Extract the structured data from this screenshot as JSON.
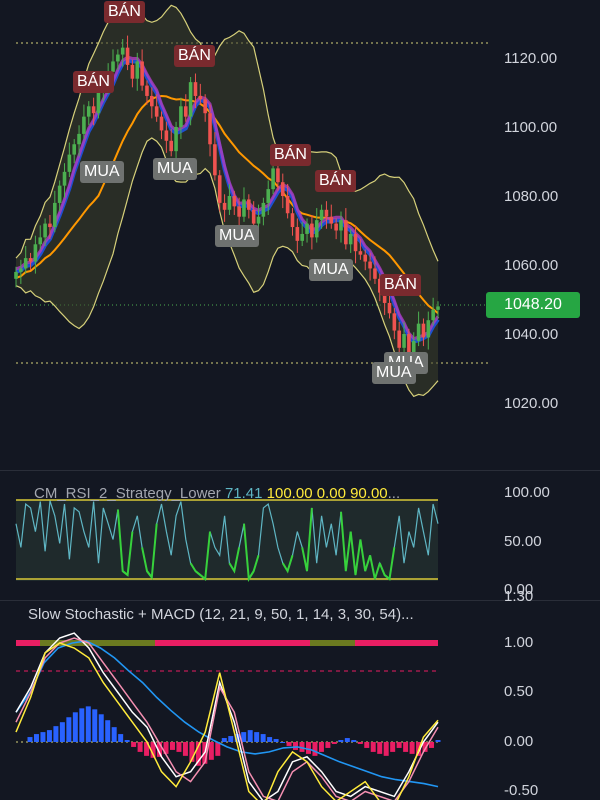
{
  "colors": {
    "background": "#131722",
    "bullish": "#26a69a",
    "bullish_candle": "#4caf50",
    "bearish_candle": "#ef5350",
    "price_tag": "#26a643",
    "sell_tag": "#7a2a2e",
    "buy_tag": "#6f7270",
    "bollinger": "#d6d07a",
    "orange_ma": "#ff9800",
    "rsi_line": "#5fb6c4",
    "oversold": "#37d13c",
    "stoch_k": "#ffffff",
    "stoch_d": "#f48fb1",
    "macd_line": "#2196f3",
    "macd_hist_pos": "#2962ff",
    "macd_hist_neg": "#e91e63",
    "yellow": "#ffeb3b"
  },
  "main_chart": {
    "price_axis": [
      "1120.00",
      "1100.00",
      "1080.00",
      "1060.00",
      "1040.00",
      "1020.00"
    ],
    "current_price": "1048.20",
    "signals": [
      {
        "type": "sell",
        "label": "BÁN"
      },
      {
        "type": "sell",
        "label": "BÁN"
      },
      {
        "type": "sell",
        "label": "BÁN"
      },
      {
        "type": "sell",
        "label": "BÁN"
      },
      {
        "type": "sell",
        "label": "BÁN"
      },
      {
        "type": "sell",
        "label": "BÁN"
      },
      {
        "type": "buy",
        "label": "MUA"
      },
      {
        "type": "buy",
        "label": "MUA"
      },
      {
        "type": "buy",
        "label": "MUA"
      },
      {
        "type": "buy",
        "label": "MUA"
      },
      {
        "type": "buy",
        "label": "MUA"
      },
      {
        "type": "buy",
        "label": "MUA"
      }
    ],
    "closes": [
      1058,
      1059,
      1062,
      1061,
      1066,
      1068,
      1072,
      1071,
      1078,
      1083,
      1087,
      1092,
      1095,
      1098,
      1103,
      1106,
      1104,
      1110,
      1113,
      1116,
      1119,
      1121,
      1123,
      1118,
      1114,
      1119,
      1112,
      1109,
      1106,
      1103,
      1099,
      1096,
      1093,
      1100,
      1106,
      1103,
      1113,
      1109,
      1108,
      1104,
      1095,
      1086,
      1078,
      1076,
      1080,
      1077,
      1074,
      1079,
      1076,
      1072,
      1074,
      1078,
      1082,
      1088,
      1084,
      1080,
      1075,
      1071,
      1067,
      1069,
      1072,
      1068,
      1073,
      1076,
      1074,
      1072,
      1070,
      1073,
      1066,
      1069,
      1064,
      1063,
      1061,
      1059,
      1056,
      1052,
      1049,
      1046,
      1041,
      1036,
      1040,
      1034,
      1038,
      1043,
      1039,
      1044,
      1047,
      1048
    ]
  },
  "rsi_panel": {
    "title": "CM_RSI_2_Strategy_Lower",
    "value": "71.41",
    "upper": "100.00",
    "lower": "0.00",
    "third": "90.00",
    "ellipsis": "...",
    "axis": [
      "100.00",
      "50.00",
      "0.00"
    ]
  },
  "macd_panel": {
    "title": "Slow Stochastic + MACD (12, 21, 9, 50, 1, 14, 3, 30, 54)...",
    "axis_top": "1.30",
    "axis": [
      "1.00",
      "0.50",
      "0.00",
      "-0.50"
    ]
  }
}
